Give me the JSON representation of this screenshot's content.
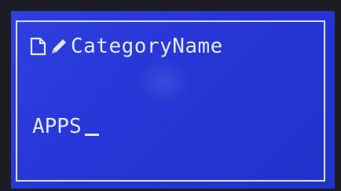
{
  "screen": {
    "title": "CategoryName",
    "title_icons": [
      "document-icon",
      "pencil-icon"
    ],
    "input": {
      "value": "APPS"
    }
  },
  "colors": {
    "lcd_background": "#2a3ad8",
    "lcd_text": "#e6e8fb",
    "bezel": "#1c1d24"
  }
}
